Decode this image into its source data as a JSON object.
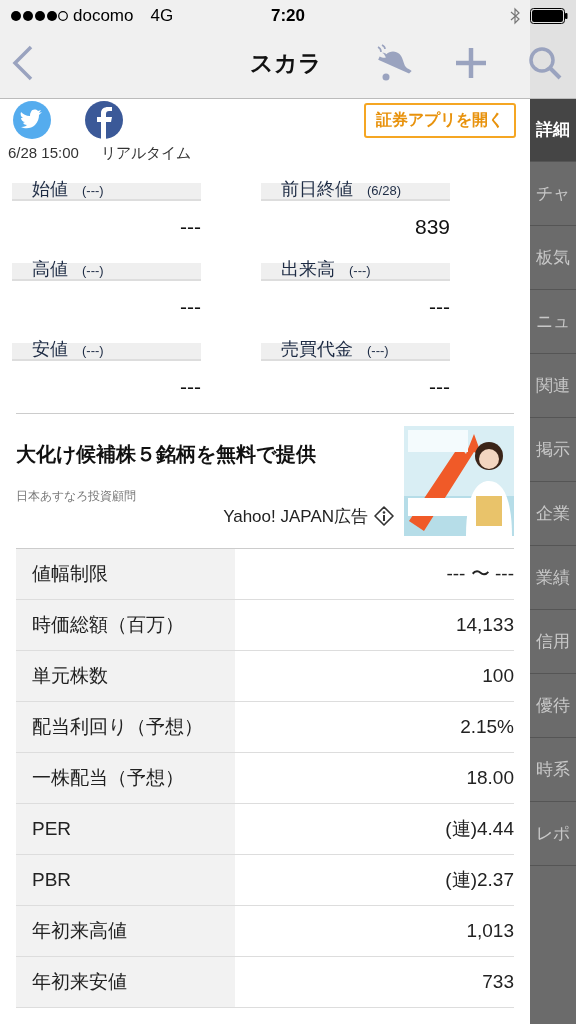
{
  "status_bar": {
    "carrier": "docomo",
    "network": "4G",
    "time": "7:20"
  },
  "background_header": {
    "open_app_button": "証券アプリを開く"
  },
  "nav_bar": {
    "title": "スカラ"
  },
  "timestamp": {
    "time": "6/28 15:00",
    "mode": "リアルタイム"
  },
  "stats": [
    {
      "label": "始値",
      "note": "(---)",
      "value": "---"
    },
    {
      "label": "前日終値",
      "note": "(6/28)",
      "value": "839"
    },
    {
      "label": "高値",
      "note": "(---)",
      "value": "---"
    },
    {
      "label": "出来高",
      "note": "(---)",
      "value": "---"
    },
    {
      "label": "安値",
      "note": "(---)",
      "value": "---"
    },
    {
      "label": "売買代金",
      "note": "(---)",
      "value": "---"
    }
  ],
  "ad": {
    "headline": "大化け候補株５銘柄を無料で提供",
    "sponsor": "日本あすなろ投資顧問",
    "label": "Yahoo! JAPAN広告"
  },
  "table": {
    "rows": [
      {
        "label": "値幅制限",
        "value": "--- 〜 ---"
      },
      {
        "label": "時価総額（百万）",
        "value": "14,133"
      },
      {
        "label": "単元株数",
        "value": "100"
      },
      {
        "label": "配当利回り（予想）",
        "value": "2.15%"
      },
      {
        "label": "一株配当（予想）",
        "value": "18.00"
      },
      {
        "label": "PER",
        "value": "(連)4.44"
      },
      {
        "label": "PBR",
        "value": "(連)2.37"
      },
      {
        "label": "年初来高値",
        "value": "1,013"
      },
      {
        "label": "年初来安値",
        "value": "733"
      }
    ]
  },
  "side_tabs": [
    {
      "label": "詳細",
      "selected": true
    },
    {
      "label": "チャ",
      "selected": false
    },
    {
      "label": "板気",
      "selected": false
    },
    {
      "label": "ニュ",
      "selected": false
    },
    {
      "label": "関連",
      "selected": false
    },
    {
      "label": "掲示",
      "selected": false
    },
    {
      "label": "企業",
      "selected": false
    },
    {
      "label": "業績",
      "selected": false
    },
    {
      "label": "信用",
      "selected": false
    },
    {
      "label": "優待",
      "selected": false
    },
    {
      "label": "時系",
      "selected": false
    },
    {
      "label": "レポ",
      "selected": false
    }
  ]
}
